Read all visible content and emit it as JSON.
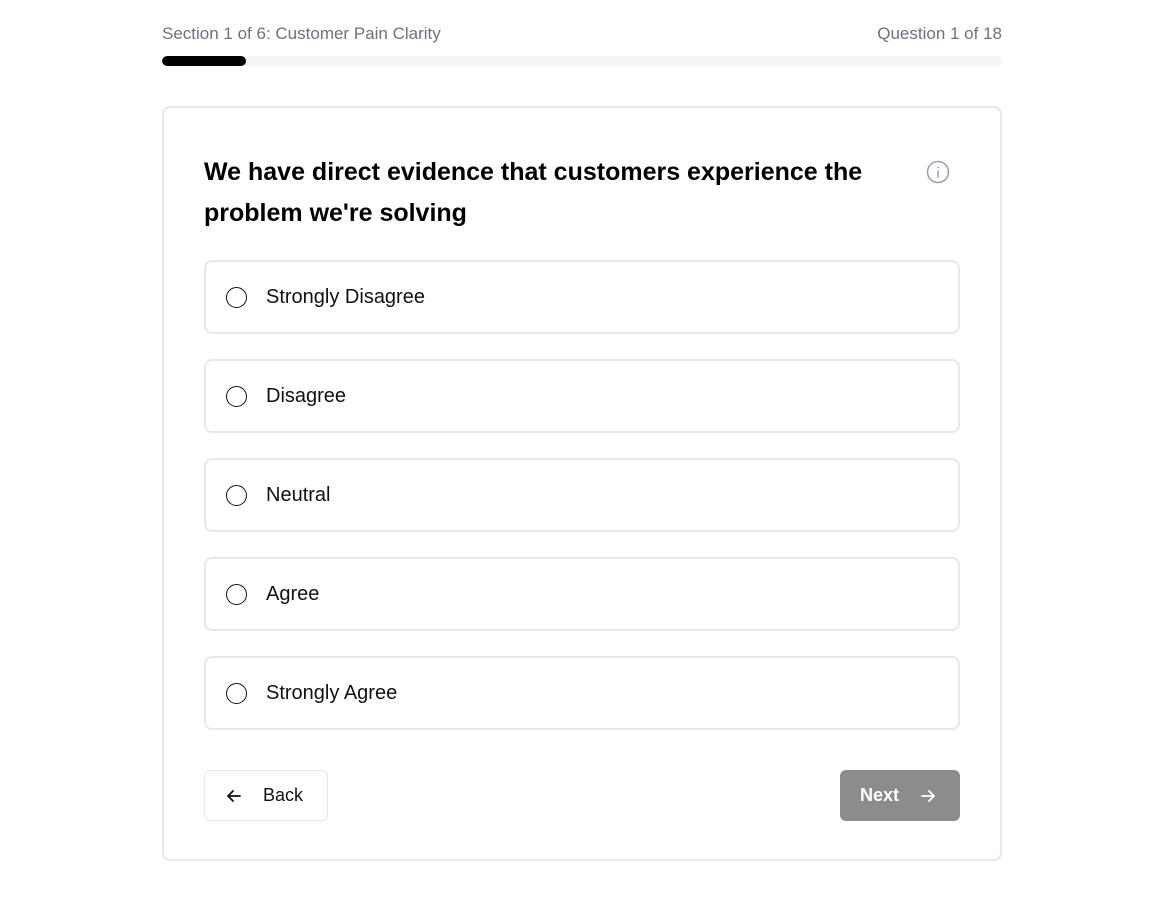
{
  "progress": {
    "section_text": "Section 1 of 6: Customer Pain Clarity",
    "question_text": "Question 1 of 18",
    "fraction": 0.1
  },
  "question": {
    "text": "We have direct evidence that customers experience the problem we're solving",
    "info_icon": "info-circle-icon"
  },
  "options": [
    {
      "label": "Strongly Disagree",
      "selected": false
    },
    {
      "label": "Disagree",
      "selected": false
    },
    {
      "label": "Neutral",
      "selected": false
    },
    {
      "label": "Agree",
      "selected": false
    },
    {
      "label": "Strongly Agree",
      "selected": false
    }
  ],
  "navigation": {
    "back_label": "Back",
    "back_icon": "arrow-left-icon",
    "next_label": "Next",
    "next_icon": "arrow-right-icon",
    "next_disabled": true
  },
  "colors": {
    "progress_fill": "#000000",
    "progress_track": "#f3f4f6",
    "next_button_disabled": "#8c8c8c",
    "border": "#e5e7eb",
    "muted_text": "#6b7280"
  }
}
